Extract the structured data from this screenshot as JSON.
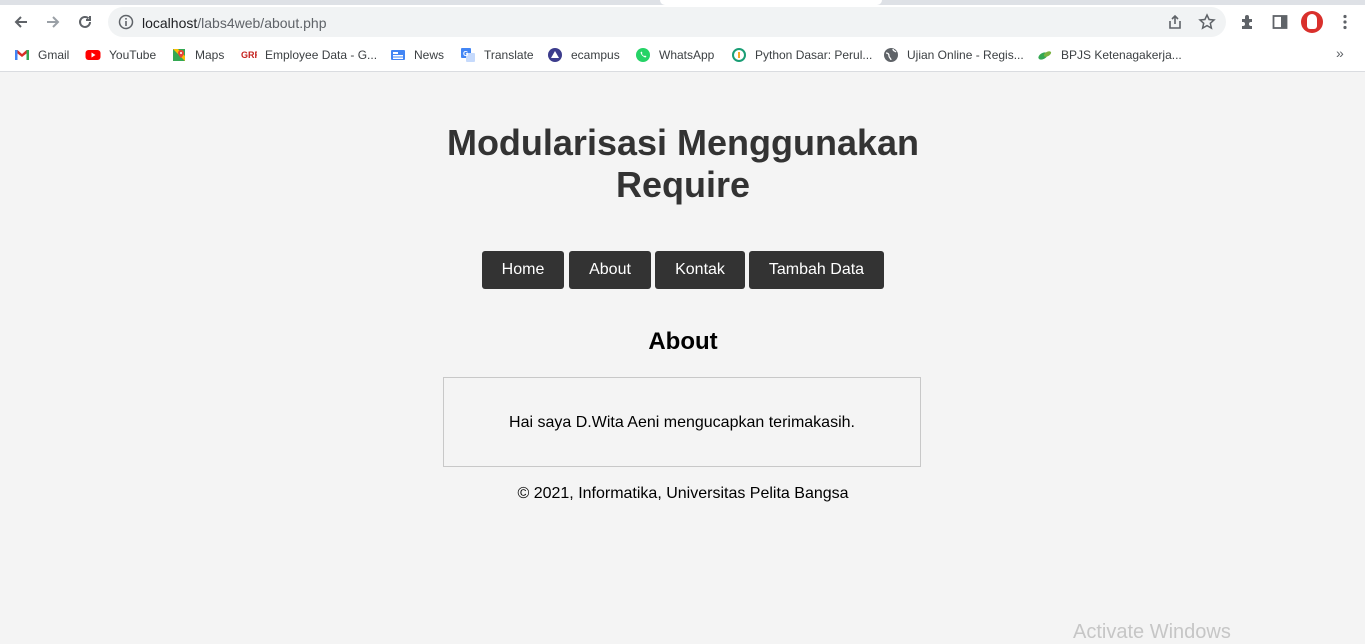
{
  "browser": {
    "url_host": "localhost",
    "url_path": "/labs4web/about.php",
    "bookmarks": [
      {
        "label": "Gmail",
        "icon": "gmail-icon"
      },
      {
        "label": "YouTube",
        "icon": "youtube-icon"
      },
      {
        "label": "Maps",
        "icon": "maps-icon"
      },
      {
        "label": "Employee Data - G...",
        "icon": "grp-icon"
      },
      {
        "label": "News",
        "icon": "news-icon"
      },
      {
        "label": "Translate",
        "icon": "translate-icon"
      },
      {
        "label": "ecampus",
        "icon": "ecampus-icon"
      },
      {
        "label": "WhatsApp",
        "icon": "whatsapp-icon"
      },
      {
        "label": "Python Dasar: Perul...",
        "icon": "python-course-icon"
      },
      {
        "label": "Ujian Online - Regis...",
        "icon": "globe-icon"
      },
      {
        "label": "BPJS Ketenagakerja...",
        "icon": "bpjs-icon"
      }
    ],
    "more_label": "»"
  },
  "site": {
    "title": "Modularisasi Menggunakan Require",
    "nav": [
      "Home",
      "About",
      "Kontak",
      "Tambah Data"
    ]
  },
  "main": {
    "heading": "About",
    "body": "Hai saya D.Wita Aeni mengucapkan terimakasih."
  },
  "footer": {
    "text": "© 2021, Informatika, Universitas Pelita Bangsa"
  },
  "system": {
    "watermark": "Activate Windows"
  },
  "colors": {
    "page_bg": "#f4f4f4",
    "nav_bg": "#333333",
    "title_color": "#333333"
  }
}
